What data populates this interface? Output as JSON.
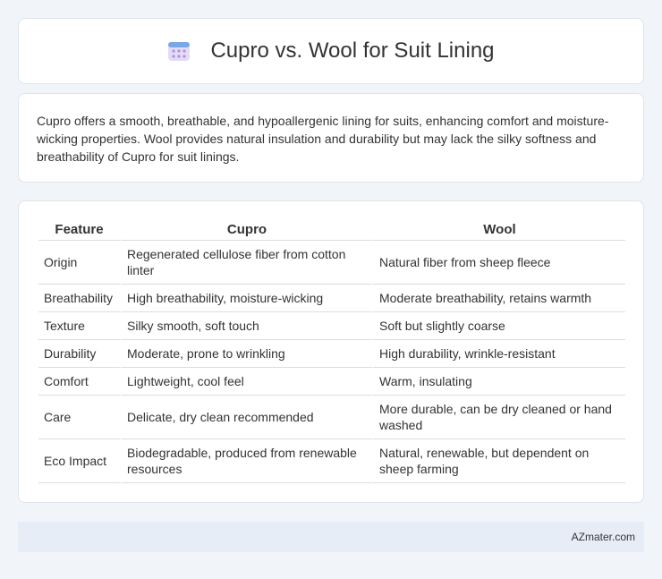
{
  "header": {
    "title": "Cupro vs. Wool for Suit Lining",
    "icon": "calendar-icon"
  },
  "summary": "Cupro offers a smooth, breathable, and hypoallergenic lining for suits, enhancing comfort and moisture-wicking properties. Wool provides natural insulation and durability but may lack the silky softness and breathability of Cupro for suit linings.",
  "table": {
    "headers": [
      "Feature",
      "Cupro",
      "Wool"
    ],
    "rows": [
      [
        "Origin",
        "Regenerated cellulose fiber from cotton linter",
        "Natural fiber from sheep fleece"
      ],
      [
        "Breathability",
        "High breathability, moisture-wicking",
        "Moderate breathability, retains warmth"
      ],
      [
        "Texture",
        "Silky smooth, soft touch",
        "Soft but slightly coarse"
      ],
      [
        "Durability",
        "Moderate, prone to wrinkling",
        "High durability, wrinkle-resistant"
      ],
      [
        "Comfort",
        "Lightweight, cool feel",
        "Warm, insulating"
      ],
      [
        "Care",
        "Delicate, dry clean recommended",
        "More durable, can be dry cleaned or hand washed"
      ],
      [
        "Eco Impact",
        "Biodegradable, produced from renewable resources",
        "Natural, renewable, but dependent on sheep farming"
      ]
    ]
  },
  "footer": {
    "site": "AZmater.com"
  },
  "colors": {
    "background": "#f1f4f9",
    "card": "#ffffff",
    "footer_bg": "#e6edf7",
    "icon_blue": "#7aa7e8",
    "icon_purple": "#b48ee0"
  }
}
